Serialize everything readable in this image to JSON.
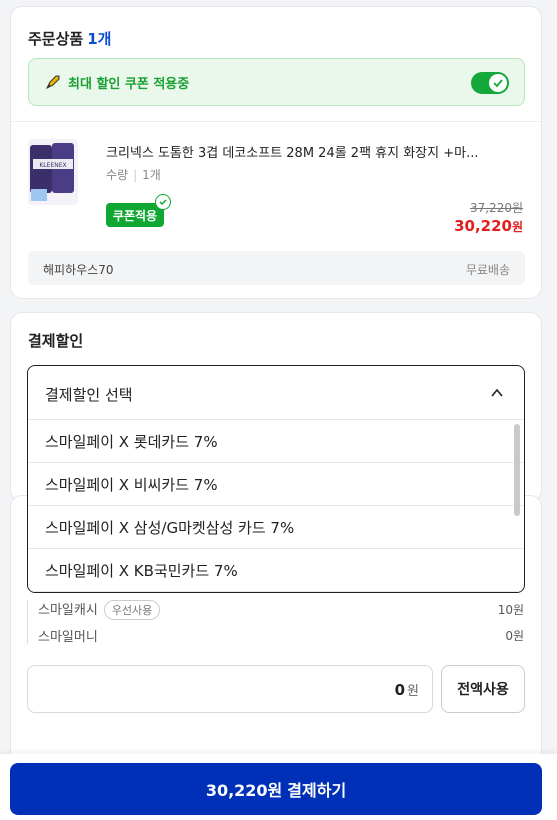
{
  "order": {
    "title": "주문상품",
    "count": "1개",
    "coupon_banner": "최대 할인 쿠폰 적용중",
    "coupon_toggle_on": true,
    "product": {
      "name": "크리넥스 도톰한 3겹 데코소프트 28M 24롤 2팩 휴지 화장지 +마...",
      "qty_label": "수량",
      "qty_value": "1개",
      "coupon_badge": "쿠폰적용",
      "original_price": "37,220원",
      "sale_price": "30,220",
      "sale_unit": "원"
    },
    "shop_name": "해피하우스70",
    "shipping": "무료배송"
  },
  "payment_discount": {
    "title": "결제할인",
    "dropdown": {
      "placeholder": "결제할인 선택",
      "options": [
        "스마일페이 X 롯데카드 7%",
        "스마일페이 X 비씨카드 7%",
        "스마일페이 X 삼성/G마켓삼성 카드 7%",
        "스마일페이 X KB국민카드 7%"
      ]
    }
  },
  "points": {
    "smile_cash_label": "스마일캐시",
    "priority_badge": "우선사용",
    "smile_cash_value": "10원",
    "smile_money_label": "스마일머니",
    "smile_money_value": "0원",
    "input_value": "0",
    "input_unit": "원",
    "use_all_button": "전액사용"
  },
  "footer": {
    "amount": "30,220원",
    "label": "결제하기"
  },
  "colors": {
    "accent": "#0030b8",
    "coupon_green": "#10a832",
    "price_red": "#e02020",
    "count_blue": "#0b4fd1"
  }
}
